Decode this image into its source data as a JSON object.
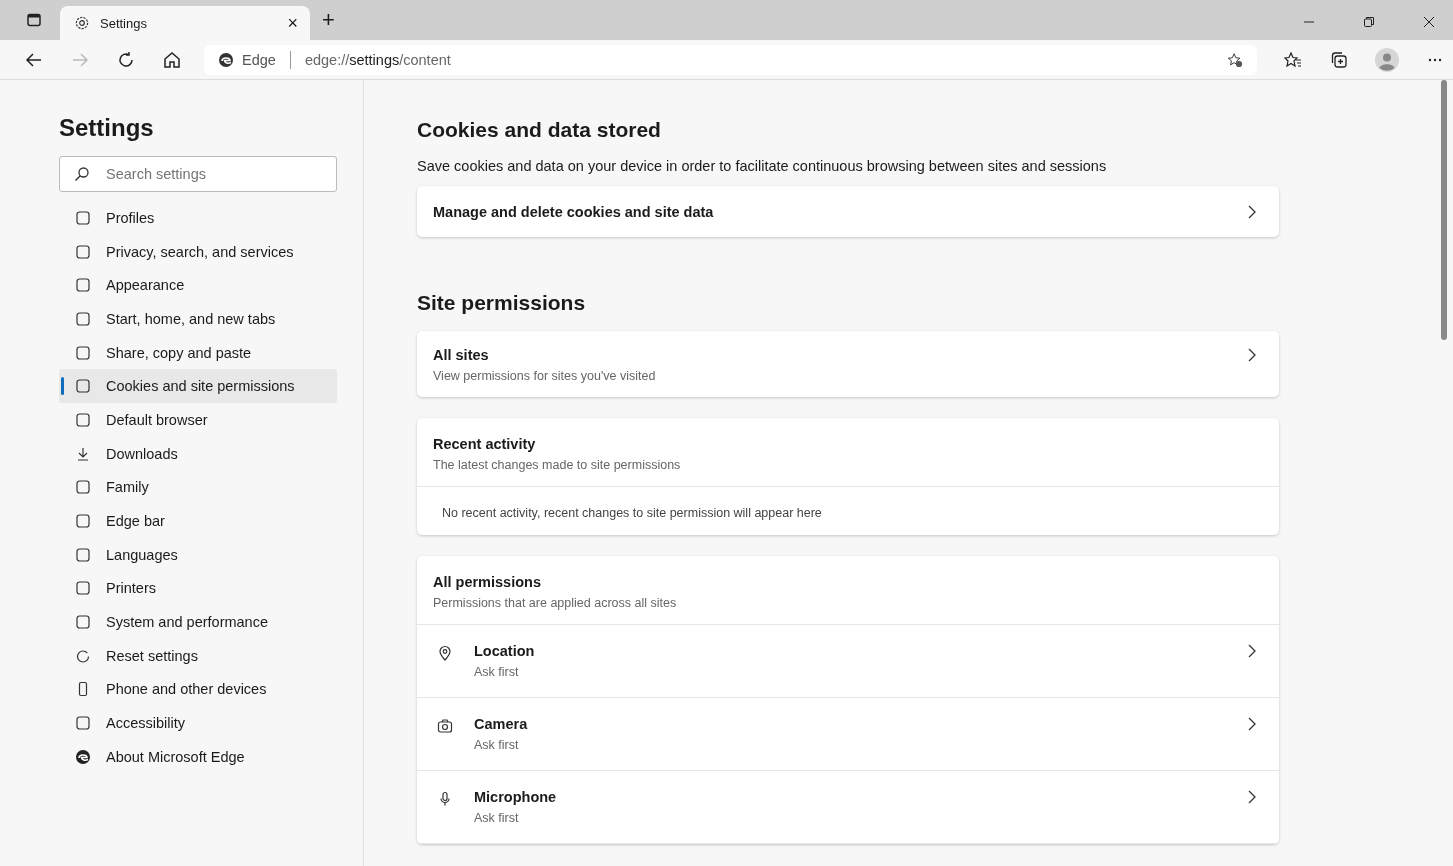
{
  "tabs": [
    {
      "title": "Settings",
      "close": "×",
      "selected": true
    }
  ],
  "new_tab": "+",
  "address_bar": {
    "site_label": "Edge",
    "url": [
      {
        "text": "edge://",
        "emphasis": false
      },
      {
        "text": "settings",
        "emphasis": true
      },
      {
        "text": "/content",
        "emphasis": false
      }
    ]
  },
  "sidebar": {
    "title": "Settings",
    "search": {
      "placeholder": "Search settings"
    },
    "items": [
      {
        "label": "Profiles",
        "selected": false
      },
      {
        "label": "Privacy, search, and services",
        "selected": false
      },
      {
        "label": "Appearance",
        "selected": false
      },
      {
        "label": "Start, home, and new tabs",
        "selected": false
      },
      {
        "label": "Share, copy and paste",
        "selected": false
      },
      {
        "label": "Cookies and site permissions",
        "selected": true
      },
      {
        "label": "Default browser",
        "selected": false
      },
      {
        "label": "Downloads",
        "selected": false
      },
      {
        "label": "Family",
        "selected": false
      },
      {
        "label": "Edge bar",
        "selected": false
      },
      {
        "label": "Languages",
        "selected": false
      },
      {
        "label": "Printers",
        "selected": false
      },
      {
        "label": "System and performance",
        "selected": false
      },
      {
        "label": "Reset settings",
        "selected": false
      },
      {
        "label": "Phone and other devices",
        "selected": false
      },
      {
        "label": "Accessibility",
        "selected": false
      },
      {
        "label": "About Microsoft Edge",
        "selected": false
      }
    ]
  },
  "cookies_section": {
    "heading": "Cookies and data stored",
    "description": "Save cookies and data on your device in order to facilitate continuous browsing between sites and sessions",
    "link_card": {
      "title": "Manage and delete cookies and site data"
    }
  },
  "site_permissions": {
    "heading": "Site permissions",
    "all_sites": {
      "title": "All sites",
      "subtitle": "View permissions for sites you've visited"
    },
    "recent_activity": {
      "title": "Recent activity",
      "subtitle": "The latest changes made to site permissions",
      "empty_message": "No recent activity, recent changes to site permission will appear here"
    },
    "all_permissions": {
      "title": "All permissions",
      "subtitle": "Permissions that are applied across all sites",
      "items": [
        {
          "name": "Location",
          "value": "Ask first"
        },
        {
          "name": "Camera",
          "value": "Ask first"
        },
        {
          "name": "Microphone",
          "value": "Ask first"
        }
      ]
    }
  }
}
